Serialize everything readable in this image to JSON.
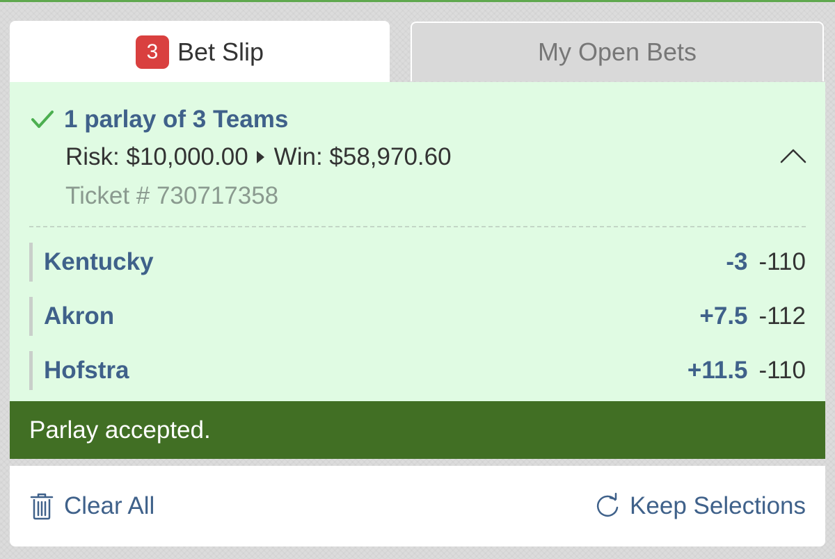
{
  "tabs": {
    "bet_slip": {
      "badge": "3",
      "label": "Bet Slip"
    },
    "open_bets": {
      "label": "My Open Bets"
    }
  },
  "parlay": {
    "title": "1 parlay of 3 Teams",
    "risk": "Risk: $10,000.00",
    "win": "Win: $58,970.60",
    "ticket": "Ticket # 730717358",
    "legs": [
      {
        "team": "Kentucky",
        "line": "-3",
        "price": "-110"
      },
      {
        "team": "Akron",
        "line": "+7.5",
        "price": "-112"
      },
      {
        "team": "Hofstra",
        "line": "+11.5",
        "price": "-110"
      }
    ]
  },
  "status": {
    "message": "Parlay accepted."
  },
  "footer": {
    "clear_label": "Clear All",
    "keep_label": "Keep Selections"
  },
  "colors": {
    "accent": "#3f618a",
    "success_bar": "#416f24",
    "panel_bg": "#e0fbe3",
    "badge": "#d9403f",
    "check": "#4caf50"
  },
  "icons": {
    "check": "check-icon",
    "caret": "caret-right-icon",
    "collapse": "chevron-up-icon",
    "clear": "trash-icon",
    "keep": "refresh-icon"
  }
}
